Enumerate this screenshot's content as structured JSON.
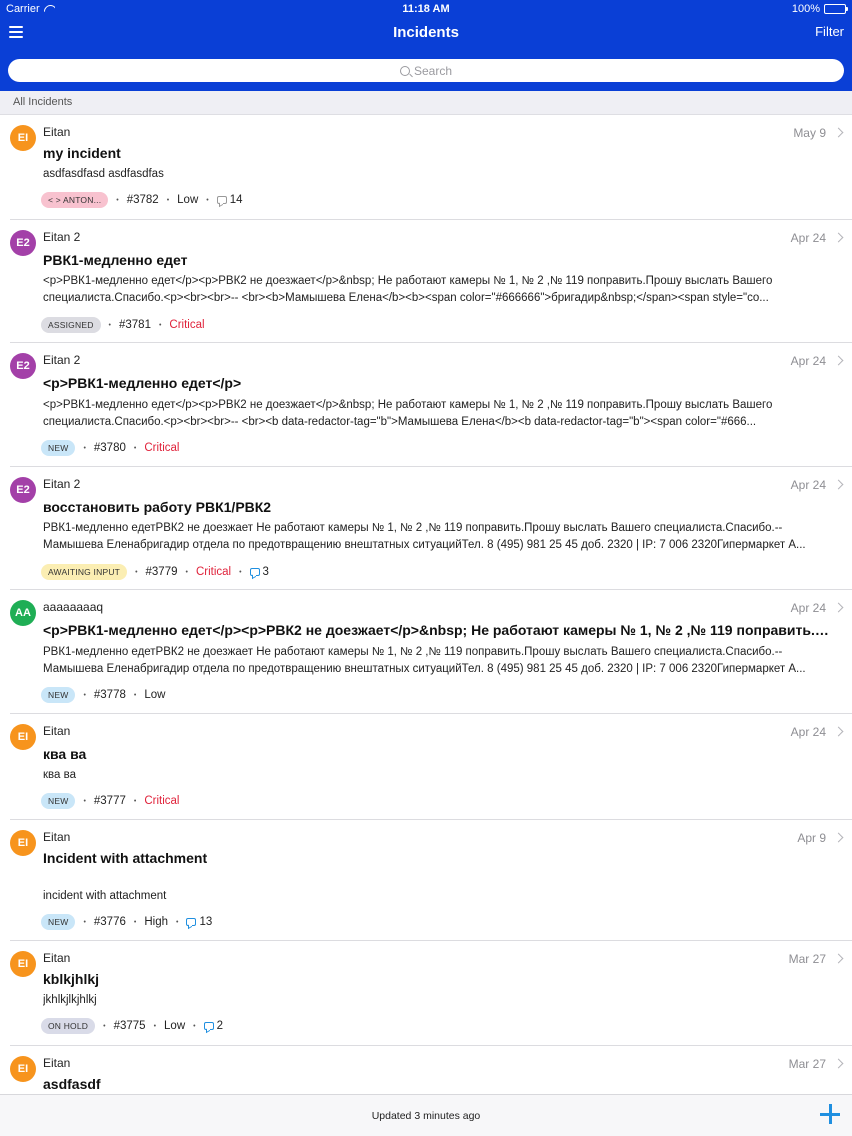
{
  "status": {
    "carrier": "Carrier",
    "time": "11:18 AM",
    "battery": "100%"
  },
  "nav": {
    "title": "Incidents",
    "filter": "Filter"
  },
  "search": {
    "placeholder": "Search"
  },
  "section": "All Incidents",
  "colors": {
    "header": "#0a3fd6",
    "critical": "#e0233b",
    "accent": "#1f8fe0"
  },
  "items": [
    {
      "initials": "EI",
      "avatar_color": "#f7941d",
      "author": "Eitan",
      "date": "May 9",
      "title": "my incident",
      "desc": [
        "asdfasdfasd asdfasdfas"
      ],
      "badge": "< > ANTON...",
      "badge_bg": "#f8c2cf",
      "number": "#3782",
      "priority": "Low",
      "priority_critical": false,
      "comments": "14",
      "comment_style": "gray"
    },
    {
      "initials": "E2",
      "avatar_color": "#a340a8",
      "author": "Eitan 2",
      "date": "Apr 24",
      "title": "РВК1-медленно едет",
      "desc": [
        "<p>РВК1-медленно едет</p><p>РВК2 не доезжает</p>&nbsp; Не работают камеры № 1, № 2 ,№ 119 поправить.Прошу выслать Вашего",
        "специалиста.Спасибо.<p><br><br>-- <br><b>Мамышева Елена</b><b><span color=\"#666666\">бригадир&nbsp;</span><span style=\"co..."
      ],
      "badge": "ASSIGNED",
      "badge_bg": "#dcdce2",
      "number": "#3781",
      "priority": "Critical",
      "priority_critical": true,
      "comments": "",
      "comment_style": ""
    },
    {
      "initials": "E2",
      "avatar_color": "#a340a8",
      "author": "Eitan 2",
      "date": "Apr 24",
      "title": "<p>РВК1-медленно едет</p>",
      "desc": [
        "<p>РВК1-медленно едет</p><p>РВК2 не доезжает</p>&nbsp; Не работают камеры № 1, № 2 ,№ 119 поправить.Прошу выслать Вашего",
        "специалиста.Спасибо.<p><br><br>-- <br><b data-redactor-tag=\"b\">Мамышева Елена</b><b data-redactor-tag=\"b\"><span color=\"#666..."
      ],
      "badge": "NEW",
      "badge_bg": "#c9e6f8",
      "number": "#3780",
      "priority": "Critical",
      "priority_critical": true,
      "comments": "",
      "comment_style": ""
    },
    {
      "initials": "E2",
      "avatar_color": "#a340a8",
      "author": "Eitan 2",
      "date": "Apr 24",
      "title": "восстановить работу РВК1/РВК2",
      "desc": [
        "РВК1-медленно едетРВК2 не доезжает  Не работают камеры № 1, № 2 ,№ 119 поправить.Прошу выслать Вашего специалиста.Спасибо.--",
        "Мамышева Еленабригадир отдела по предотвращению внештатных ситуацийТел. 8 (495) 981 25 45 доб. 2320 | IP: 7 006 2320Гипермаркет А..."
      ],
      "badge": "AWAITING INPUT",
      "badge_bg": "#fbeeb3",
      "number": "#3779",
      "priority": "Critical",
      "priority_critical": true,
      "comments": "3",
      "comment_style": "blue"
    },
    {
      "initials": "AA",
      "avatar_color": "#1fae55",
      "author": "aaaaaaaaq",
      "date": "Apr 24",
      "title": "<p>РВК1-медленно едет</p><p>РВК2 не доезжает</p>&nbsp; Не работают камеры № 1, № 2 ,№ 119 поправить.Про...",
      "desc": [
        "РВК1-медленно едетРВК2 не доезжает  Не работают камеры № 1, № 2 ,№ 119 поправить.Прошу выслать Вашего специалиста.Спасибо.--",
        "Мамышева Еленабригадир отдела по предотвращению внештатных ситуацийТел. 8 (495) 981 25 45 доб. 2320 | IP: 7 006 2320Гипермаркет А..."
      ],
      "badge": "NEW",
      "badge_bg": "#c9e6f8",
      "number": "#3778",
      "priority": "Low",
      "priority_critical": false,
      "comments": "",
      "comment_style": ""
    },
    {
      "initials": "EI",
      "avatar_color": "#f7941d",
      "author": "Eitan",
      "date": "Apr 24",
      "title": "ква ва",
      "desc": [
        "ква ва"
      ],
      "badge": "NEW",
      "badge_bg": "#c9e6f8",
      "number": "#3777",
      "priority": "Critical",
      "priority_critical": true,
      "comments": "",
      "comment_style": ""
    },
    {
      "initials": "EI",
      "avatar_color": "#f7941d",
      "author": "Eitan",
      "date": "Apr 9",
      "title": "Incident with attachment",
      "desc": [
        "",
        "incident with attachment"
      ],
      "badge": "NEW",
      "badge_bg": "#c9e6f8",
      "number": "#3776",
      "priority": "High",
      "priority_critical": false,
      "comments": "13",
      "comment_style": "blue"
    },
    {
      "initials": "EI",
      "avatar_color": "#f7941d",
      "author": "Eitan",
      "date": "Mar 27",
      "title": "kblkjhlkj",
      "desc": [
        "jkhlkjlkjhlkj"
      ],
      "badge": "ON HOLD",
      "badge_bg": "#d9dbe8",
      "number": "#3775",
      "priority": "Low",
      "priority_critical": false,
      "comments": "2",
      "comment_style": "blue"
    },
    {
      "initials": "EI",
      "avatar_color": "#f7941d",
      "author": "Eitan",
      "date": "Mar 27",
      "title": "asdfasdf",
      "desc": [],
      "badge": "",
      "badge_bg": "",
      "number": "",
      "priority": "",
      "priority_critical": false,
      "comments": "",
      "comment_style": ""
    }
  ],
  "footer": {
    "updated": "Updated 3 minutes ago"
  }
}
